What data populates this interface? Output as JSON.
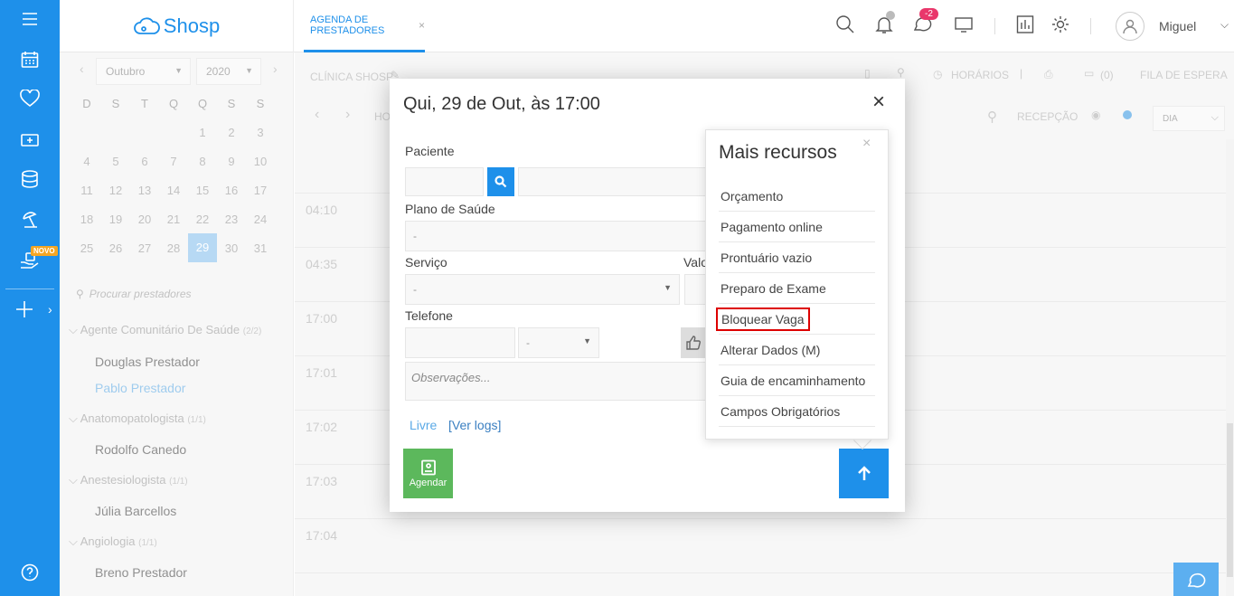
{
  "app": {
    "logo_text": "Shosp"
  },
  "leftbar": {
    "novo_badge": "NOVO"
  },
  "topbar": {
    "tab_label": "AGENDA DE PRESTADORES",
    "tab_close": "×",
    "messages_badge": "-2",
    "user_name": "Miguel"
  },
  "calendar": {
    "month": "Outubro",
    "year": "2020",
    "weekdays": [
      "D",
      "S",
      "T",
      "Q",
      "Q",
      "S",
      "S"
    ],
    "weeks": [
      [
        "",
        "",
        "",
        "",
        "1",
        "2",
        "3"
      ],
      [
        "4",
        "5",
        "6",
        "7",
        "8",
        "9",
        "10"
      ],
      [
        "11",
        "12",
        "13",
        "14",
        "15",
        "16",
        "17"
      ],
      [
        "18",
        "19",
        "20",
        "21",
        "22",
        "23",
        "24"
      ],
      [
        "25",
        "26",
        "27",
        "28",
        "29",
        "30",
        "31"
      ]
    ],
    "selected_day": "29"
  },
  "providers": {
    "search_placeholder": "Procurar prestadores",
    "groups": [
      {
        "name": "Agente Comunitário De Saúde",
        "count": "(2/2)"
      },
      {
        "name": "Anatomopatologista",
        "count": "(1/1)"
      },
      {
        "name": "Anestesiologista",
        "count": "(1/1)"
      },
      {
        "name": "Angiologia",
        "count": "(1/1)"
      }
    ],
    "names": [
      "Douglas Prestador",
      "Pablo Prestador",
      "Rodolfo Canedo",
      "Júlia Barcellos",
      "Breno Prestador"
    ]
  },
  "main": {
    "clinic": "CLÍNICA SHOSP",
    "horarios": "HORÁRIOS",
    "count": "(0)",
    "waitlist": "FILA DE ESPERA",
    "hoje": "HO",
    "reception": "RECEPÇÃO",
    "view": "DIA",
    "times": [
      "04:10",
      "04:35",
      "17:00",
      "17:01",
      "17:02",
      "17:03",
      "17:04"
    ]
  },
  "modal": {
    "title": "Qui, 29 de Out, às 17:00",
    "close": "×",
    "paciente_label": "Paciente",
    "plano_label": "Plano de Saúde",
    "plano_value": "-",
    "servico_label": "Serviço",
    "servico_value": "-",
    "valor_label": "Valo",
    "telefone_label": "Telefone",
    "telefone_type": "-",
    "obs_placeholder": "Observações...",
    "status": "Livre",
    "logs": "[Ver logs]",
    "agendar": "Agendar"
  },
  "popover": {
    "title": "Mais recursos",
    "close": "×",
    "items": [
      "Orçamento",
      "Pagamento online",
      "Prontuário vazio",
      "Preparo de Exame",
      "Bloquear Vaga",
      "Alterar Dados (M)",
      "Guia de encaminhamento",
      "Campos Obrigatórios"
    ],
    "highlighted_item": "Bloquear Vaga"
  },
  "colors": {
    "primary": "#1e90ea",
    "success": "#5cb85c",
    "badge": "#e9376b",
    "highlight": "#dd0000"
  }
}
